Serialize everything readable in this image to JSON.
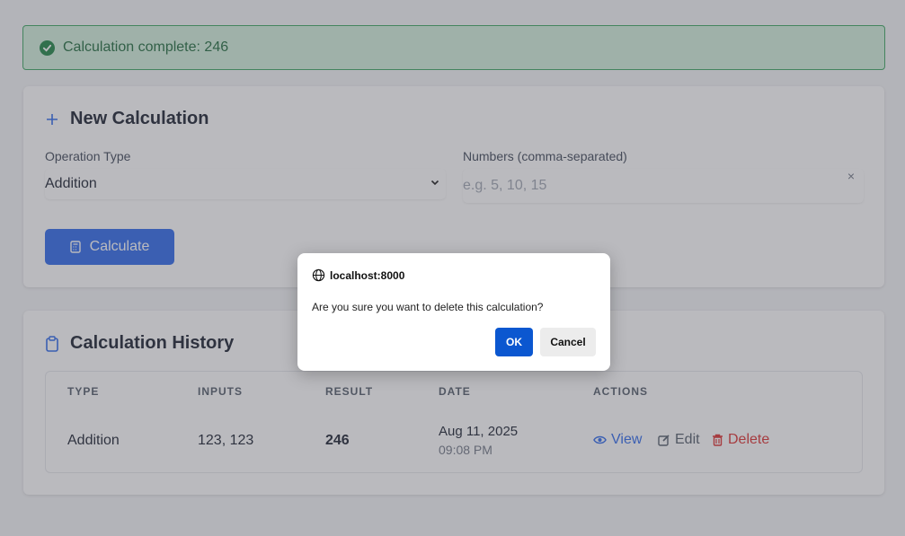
{
  "alert": {
    "message": "Calculation complete: 246"
  },
  "new_calc": {
    "title": "New Calculation",
    "operation_label": "Operation Type",
    "operation_value": "Addition",
    "numbers_label": "Numbers (comma-separated)",
    "numbers_placeholder": "e.g. 5, 10, 15",
    "clear_symbol": "×",
    "calculate_label": "Calculate"
  },
  "history": {
    "title": "Calculation History",
    "columns": [
      "TYPE",
      "INPUTS",
      "RESULT",
      "DATE",
      "ACTIONS"
    ],
    "rows": [
      {
        "type": "Addition",
        "inputs": "123, 123",
        "result": "246",
        "date": "Aug 11, 2025",
        "time": "09:08 PM"
      }
    ],
    "actions": {
      "view": "View",
      "edit": "Edit",
      "delete": "Delete"
    }
  },
  "dialog": {
    "origin": "localhost:8000",
    "message": "Are you sure you want to delete this calculation?",
    "ok_label": "OK",
    "cancel_label": "Cancel"
  },
  "colors": {
    "primary": "#2563eb",
    "success_bg": "#d1f0db",
    "success_text": "#166534",
    "danger": "#dc2626",
    "dialog_ok": "#0b57d0"
  },
  "icons": {
    "alert": "check-circle-icon",
    "new_calc": "plus-icon",
    "calculate": "calculator-icon",
    "history": "clipboard-icon",
    "view": "eye-icon",
    "edit": "edit-icon",
    "delete": "trash-icon",
    "origin": "globe-icon",
    "select": "chevron-down-icon"
  }
}
